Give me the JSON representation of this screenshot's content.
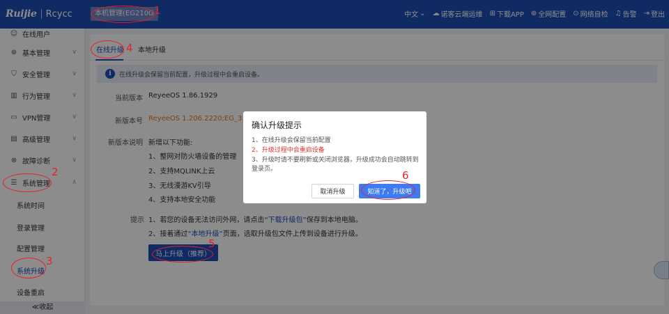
{
  "header": {
    "logo_brand": "Ruijie",
    "logo_product": "Rcycc",
    "device_label": "本机管理(EG210G",
    "nav": [
      {
        "icon": "chevron-down-icon",
        "label": "中文"
      },
      {
        "icon": "cloud-icon",
        "label": "诺客云端运维"
      },
      {
        "icon": "download-icon",
        "label": "下载APP"
      },
      {
        "icon": "globe-icon",
        "label": "全网配置"
      },
      {
        "icon": "search-icon",
        "label": "网络自检"
      },
      {
        "icon": "bell-icon",
        "label": "告警"
      },
      {
        "icon": "logout-icon",
        "label": "登出"
      }
    ]
  },
  "sidebar": {
    "top_partial": "在线用户",
    "items": [
      {
        "icon": "globe-icon",
        "label": "基本管理"
      },
      {
        "icon": "shield-icon",
        "label": "安全管理"
      },
      {
        "icon": "chart-icon",
        "label": "行为管理"
      },
      {
        "icon": "monitor-icon",
        "label": "VPN管理"
      },
      {
        "icon": "layers-icon",
        "label": "高级管理"
      },
      {
        "icon": "diagnose-icon",
        "label": "故障诊断"
      },
      {
        "icon": "settings-icon",
        "label": "系统管理"
      }
    ],
    "sub_items": [
      "系统时间",
      "登录管理",
      "配置管理",
      "系统升级",
      "设备重启"
    ],
    "collapse_label": "≪收起"
  },
  "main": {
    "tabs": [
      "在线升级",
      "本地升级"
    ],
    "notice": "在线升级会保留当前配置，升级过程中会重启设备。",
    "current_version_label": "当前版本",
    "current_version": "ReyeeOS 1.86.1929",
    "new_version_label": "新版本号",
    "new_version": "ReyeeOS 1.206.2220;EG_3.0(1)B1",
    "desc_label": "新版本说明",
    "desc_title": "新增以下功能:",
    "features": [
      "1、整网对防火墙设备的管理",
      "2、支持MQLINK上云",
      "3、无线漫游KV引导",
      "4、支持本地安全功能"
    ],
    "tips_label": "提示",
    "tip1_prefix": "1、若您的设备无法访问外网，请点击",
    "tip1_link": "“下载升级包”",
    "tip1_suffix": "保存到本地电脑。",
    "tip2_prefix": "2、接着通过",
    "tip2_link": "“本地升级”",
    "tip2_suffix": "页面，选取升级包文件上传到设备进行升级。",
    "upgrade_button": "马上升级（推荐）"
  },
  "modal": {
    "title": "确认升级提示",
    "line1": "1、在线升级会保留当前配置",
    "line2": "2、升级过程中会重启设备",
    "line3": "3、升级时请不要刷新或关闭浏览器，升级成功会自动跳转到登录页。",
    "cancel": "取消升级",
    "confirm": "知道了，升级吧"
  },
  "annotations": [
    "1",
    "2",
    "3",
    "4",
    "5",
    "6"
  ],
  "colors": {
    "header": "#1e4db7",
    "accent": "#1e4db7",
    "warning": "#e0312d",
    "version_new": "#e8761e",
    "annotation": "#e5202a"
  }
}
